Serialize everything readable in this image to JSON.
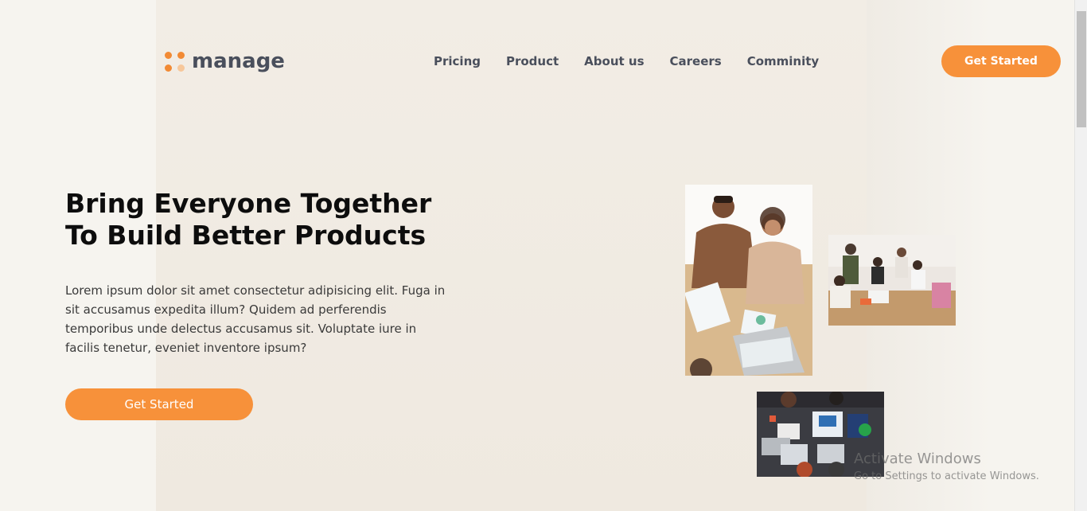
{
  "brand": {
    "name": "manage",
    "accent_color": "#f7913a",
    "icon": "four-dots-logo-icon"
  },
  "nav": {
    "items": [
      {
        "label": "Pricing"
      },
      {
        "label": "Product"
      },
      {
        "label": "About us"
      },
      {
        "label": "Careers"
      },
      {
        "label": "Comminity"
      }
    ]
  },
  "header": {
    "cta_label": "Get Started"
  },
  "hero": {
    "headline_line1": "Bring Everyone Together",
    "headline_line2": "To Build Better Products",
    "description": "Lorem ipsum dolor sit amet consectetur adipisicing elit. Fuga in sit accusamus expedita illum? Quidem ad perferendis temporibus unde delectus accusamus sit. Voluptate iure in facilis tenetur, eveniet inventore ipsum?",
    "cta_label": "Get Started"
  },
  "gallery": {
    "images": [
      {
        "description": "team-meeting-photo"
      },
      {
        "description": "group-collaboration-photo"
      },
      {
        "description": "overhead-desk-photo"
      }
    ]
  },
  "os_watermark": {
    "title": "Activate Windows",
    "subtitle": "Go to Settings to activate Windows."
  }
}
